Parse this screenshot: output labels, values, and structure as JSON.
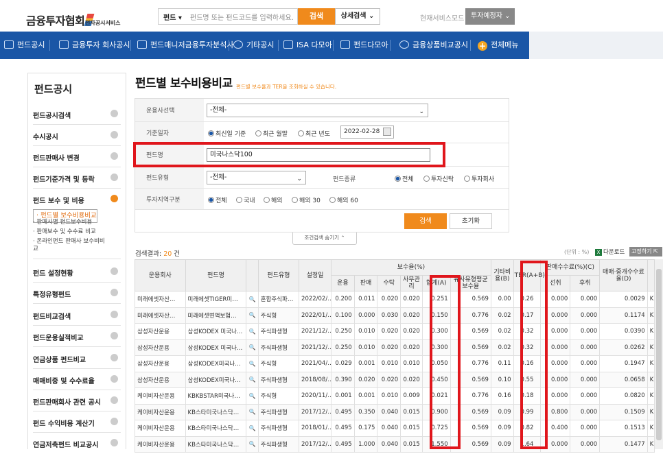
{
  "header": {
    "logo": "금융투자협회",
    "logo_sub": "전자공시서비스",
    "search_category": "펀드",
    "search_placeholder": "펀드명 또는 펀드코드를 입력하세요.",
    "search_button": "검색",
    "detail_search": "상세검색 ⌄",
    "mode_label": "현재서비스모드",
    "mode_value": "투자예정자 ⌄"
  },
  "nav": [
    {
      "label": "펀드공시",
      "icon": "chart-icon"
    },
    {
      "label": "금융투자 회사공시",
      "icon": "building-icon"
    },
    {
      "label": "펀드매니저금융투자분석사",
      "icon": "briefcase-icon"
    },
    {
      "label": "기타공시",
      "icon": "globe-icon"
    },
    {
      "label": "ISA 다모아",
      "icon": "isa-icon"
    },
    {
      "label": "펀드다모아",
      "icon": "bar-icon"
    },
    {
      "label": "금융상품비교공시",
      "icon": "coin-icon"
    },
    {
      "label": "전체메뉴",
      "icon": "plus-icon"
    }
  ],
  "sidebar": {
    "title": "펀드공시",
    "items": [
      {
        "label": "펀드공시검색"
      },
      {
        "label": "수시공시"
      },
      {
        "label": "펀드판매사 변경"
      },
      {
        "label": "펀드기준가격 및 등락"
      },
      {
        "label": "펀드 보수 및 비용"
      },
      {
        "label": "펀드 설정현황"
      },
      {
        "label": "특정유형펀드"
      },
      {
        "label": "펀드비교검색"
      },
      {
        "label": "펀드운용실적비교"
      },
      {
        "label": "연금상품 펀드비교"
      },
      {
        "label": "매매비중 및 수수료율"
      },
      {
        "label": "펀드판매회사 관련 공시"
      },
      {
        "label": "펀드 수익비용 계산기"
      },
      {
        "label": "연금저축펀드 비교공시"
      }
    ],
    "subitems": [
      "· 펀드별 보수비용비교",
      "· 판매사별 펀드보수비용",
      "· 판매보수 및 수수료 비교",
      "· 온라인펀드 판매사 보수비비",
      "  교"
    ]
  },
  "page": {
    "title": "펀드별 보수비용비교",
    "desc": "펀드별 보수율과 TER을 조회하실 수 있습니다."
  },
  "filter": {
    "company_label": "운용사선택",
    "company_value": "-전체-",
    "date_label": "기준일자",
    "date_options": [
      "최신일 기준",
      "최근 월말",
      "최근 년도"
    ],
    "date_value": "2022-02-28",
    "fund_name_label": "펀드명",
    "fund_name_value": "미국나스닥100",
    "fund_type_label": "펀드유형",
    "fund_type_value": "-전체-",
    "fund_kind_label": "펀드종류",
    "fund_kind_options": [
      "전체",
      "투자신탁",
      "투자회사"
    ],
    "region_label": "투자지역구분",
    "region_options": [
      "전체",
      "국내",
      "해외",
      "해외 30",
      "해외 60"
    ],
    "search_button": "검색",
    "reset_button": "초기화",
    "collapse_label": "조건검색 숨기기 ⌃"
  },
  "result": {
    "prefix": "검색결과: ",
    "count": "20",
    "suffix": " 건",
    "unit": "(단위 : %)",
    "download": "다운로드",
    "pin": "고정하기"
  },
  "table": {
    "headers": {
      "company": "운용회사",
      "fund": "펀드명",
      "type": "펀드유형",
      "date": "설정일",
      "fee_group": "보수율(%)",
      "mgmt": "운용",
      "sale": "판매",
      "trust": "수탁",
      "office": "사무관리",
      "total": "합계(A)",
      "similar": "유사유형평균보수율",
      "other": "기타비용(B)",
      "ter": "TER(A+B)",
      "commission_group": "판매수수료(%)(C)",
      "front": "선취",
      "back": "후취",
      "trade": "매매·중개수수료율(D)",
      "extra": ""
    },
    "rows": [
      [
        "미래에셋자산…",
        "미래에셋TIGER미…",
        "혼합주식파…",
        "2022/02/…",
        "0.200",
        "0.011",
        "0.020",
        "0.020",
        "0.251",
        "0.569",
        "0.00",
        "0.26",
        "0.000",
        "0.000",
        "0.0029",
        "K"
      ],
      [
        "미래에셋자산…",
        "미래에셋변액보험…",
        "주식형",
        "2022/01/…",
        "0.100",
        "0.000",
        "0.030",
        "0.020",
        "0.150",
        "0.776",
        "0.02",
        "0.17",
        "0.000",
        "0.000",
        "0.1174",
        "K"
      ],
      [
        "삼성자산운용",
        "삼성KODEX 미국나…",
        "주식파생형",
        "2021/12/…",
        "0.250",
        "0.010",
        "0.020",
        "0.020",
        "0.300",
        "0.569",
        "0.02",
        "0.32",
        "0.000",
        "0.000",
        "0.0390",
        "K"
      ],
      [
        "삼성자산운용",
        "삼성KODEX 미국나…",
        "주식파생형",
        "2021/12/…",
        "0.250",
        "0.010",
        "0.020",
        "0.020",
        "0.300",
        "0.569",
        "0.02",
        "0.32",
        "0.000",
        "0.000",
        "0.0262",
        "K"
      ],
      [
        "삼성자산운용",
        "삼성KODEX미국나…",
        "주식형",
        "2021/04/…",
        "0.029",
        "0.001",
        "0.010",
        "0.010",
        "0.050",
        "0.776",
        "0.11",
        "0.16",
        "0.000",
        "0.000",
        "0.1947",
        "K"
      ],
      [
        "삼성자산운용",
        "삼성KODEX미국나…",
        "주식파생형",
        "2018/08/…",
        "0.390",
        "0.020",
        "0.020",
        "0.020",
        "0.450",
        "0.569",
        "0.10",
        "0.55",
        "0.000",
        "0.000",
        "0.0658",
        "K"
      ],
      [
        "케이비자산운용",
        "KBKBSTAR미국나…",
        "주식형",
        "2020/11/…",
        "0.001",
        "0.001",
        "0.010",
        "0.009",
        "0.021",
        "0.776",
        "0.16",
        "0.18",
        "0.000",
        "0.000",
        "0.0820",
        "K"
      ],
      [
        "케이비자산운용",
        "KB스타미국나스닥…",
        "주식파생형",
        "2017/12/…",
        "0.495",
        "0.350",
        "0.040",
        "0.015",
        "0.900",
        "0.569",
        "0.09",
        "0.99",
        "0.800",
        "0.000",
        "0.1509",
        "K"
      ],
      [
        "케이비자산운용",
        "KB스타미국나스닥…",
        "주식파생형",
        "2018/01/…",
        "0.495",
        "0.175",
        "0.040",
        "0.015",
        "0.725",
        "0.569",
        "0.09",
        "0.82",
        "0.400",
        "0.000",
        "0.1513",
        "K"
      ],
      [
        "케이비자산운용",
        "KB스타미국나스닥…",
        "주식파생형",
        "2017/12/…",
        "0.495",
        "1.000",
        "0.040",
        "0.015",
        "1.550",
        "0.569",
        "0.09",
        "1.64",
        "0.000",
        "0.000",
        "0.1477",
        "K"
      ]
    ]
  },
  "colors": {
    "nav": "#1a56a6",
    "accent": "#f08a1c",
    "highlight": "#e0161c"
  }
}
